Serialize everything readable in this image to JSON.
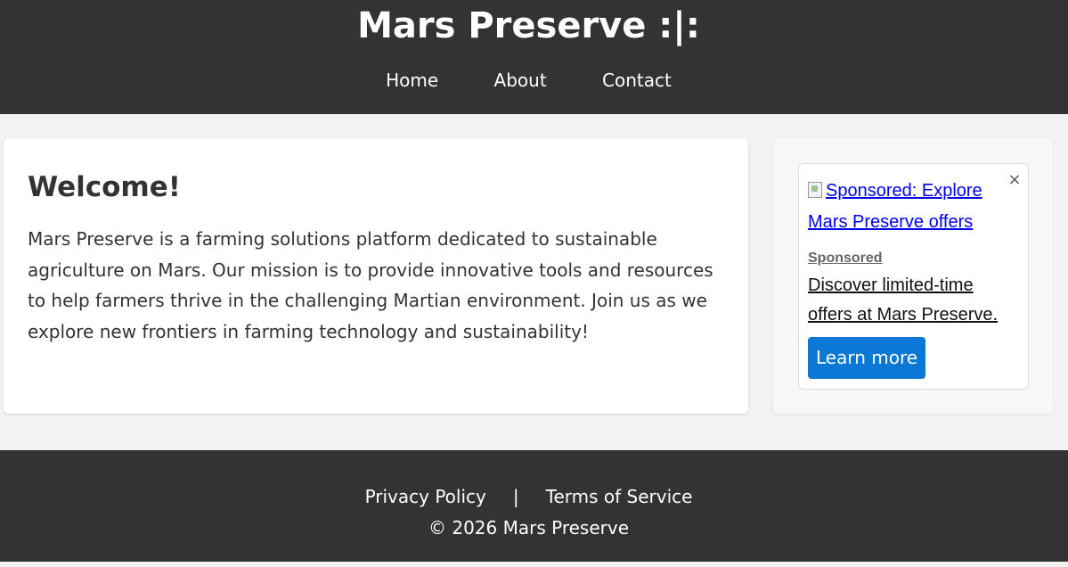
{
  "header": {
    "title": "Mars Preserve :|:",
    "nav": [
      {
        "label": "Home"
      },
      {
        "label": "About"
      },
      {
        "label": "Contact"
      }
    ]
  },
  "main": {
    "heading": "Welcome!",
    "body": "Mars Preserve is a farming solutions platform dedicated to sustainable agriculture on Mars. Our mission is to provide innovative tools and resources to help farmers thrive in the challenging Martian environment. Join us as we explore new frontiers in farming technology and sustainability!"
  },
  "ad": {
    "close_glyph": "×",
    "image_alt": "Sponsored: Explore Mars Preserve offers",
    "sponsored_label": "Sponsored",
    "description": "Discover limited-time offers at Mars Preserve.",
    "button_label": "Learn more",
    "button_color": "#0a78d4"
  },
  "footer": {
    "links": [
      {
        "label": "Privacy Policy"
      },
      {
        "label": "Terms of Service"
      }
    ],
    "separator": "|",
    "copyright": "© 2026 Mars Preserve"
  },
  "colors": {
    "header_bg": "#333333",
    "page_bg": "#f2f2f2",
    "card_bg": "#ffffff"
  }
}
